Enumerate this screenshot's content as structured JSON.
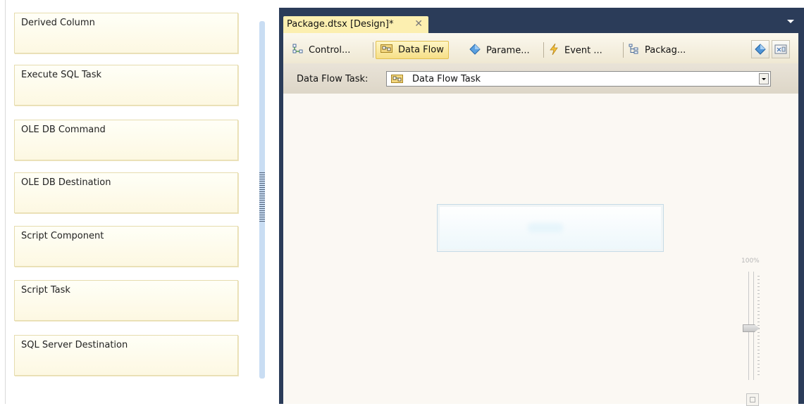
{
  "palette": {
    "items": [
      {
        "label": "Derived Column"
      },
      {
        "label": "Execute SQL Task"
      },
      {
        "label": "OLE DB Command"
      },
      {
        "label": "OLE DB Destination"
      },
      {
        "label": "Script Component"
      },
      {
        "label": "Script Task"
      },
      {
        "label": "SQL Server Destination"
      }
    ]
  },
  "document": {
    "tab_title": "Package.dtsx [Design]*",
    "close_glyph": "✕"
  },
  "toolbar": {
    "tabs": [
      {
        "label": "Control...",
        "icon": "control-flow-icon"
      },
      {
        "label": "Data Flow",
        "icon": "data-flow-icon",
        "active": true
      },
      {
        "label": "Parame...",
        "icon": "parameters-icon"
      },
      {
        "label": "Event ...",
        "icon": "event-handlers-icon"
      },
      {
        "label": "Packag...",
        "icon": "package-explorer-icon"
      }
    ],
    "right_buttons": [
      {
        "icon": "variables-icon"
      },
      {
        "icon": "toolbox-icon"
      }
    ]
  },
  "task_row": {
    "label": "Data Flow Task:",
    "selected_value": "Data Flow Task",
    "icon": "data-flow-task-icon"
  },
  "zoom": {
    "label": "100%"
  },
  "colors": {
    "window_frame": "#2b3c59",
    "tab_active": "#fcefb0",
    "palette_item_bg": "#fdf8e2",
    "splitter": "#c9ddf3"
  }
}
